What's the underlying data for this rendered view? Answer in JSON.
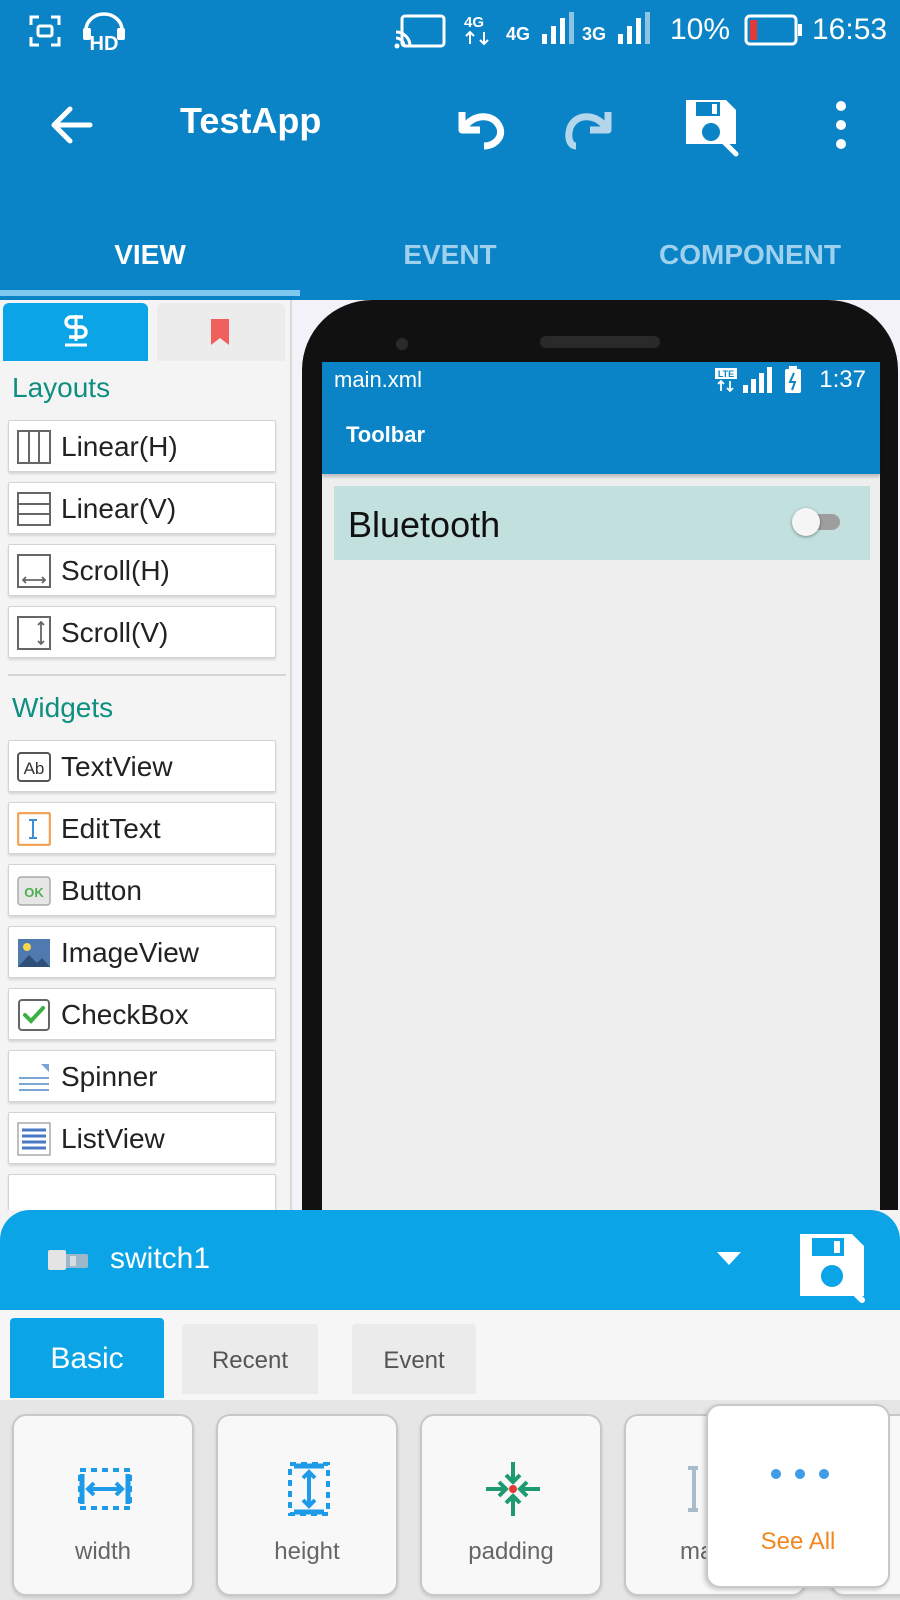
{
  "status_bar": {
    "network_4g_label": "4G",
    "network_3g_label": "3G",
    "battery": "10%",
    "time": "16:53",
    "icons": [
      "screenshot-icon",
      "hd-icon",
      "cast-icon",
      "volte-icon",
      "signal-4g-icon",
      "signal-3g-icon",
      "battery-icon"
    ]
  },
  "app_bar": {
    "title": "TestApp",
    "icons": [
      "back-arrow-icon",
      "undo-icon",
      "redo-icon",
      "save-icon",
      "overflow-menu-icon"
    ]
  },
  "tabs": [
    {
      "label": "VIEW",
      "active": true
    },
    {
      "label": "EVENT",
      "active": false
    },
    {
      "label": "COMPONENT",
      "active": false
    }
  ],
  "palette": {
    "tab_icons": [
      "palette-icon",
      "bookmark-icon"
    ],
    "layouts_title": "Layouts",
    "layouts": [
      {
        "label": "Linear(H)",
        "icon": "linear-horizontal-icon"
      },
      {
        "label": "Linear(V)",
        "icon": "linear-vertical-icon"
      },
      {
        "label": "Scroll(H)",
        "icon": "scroll-horizontal-icon"
      },
      {
        "label": "Scroll(V)",
        "icon": "scroll-vertical-icon"
      }
    ],
    "widgets_title": "Widgets",
    "widgets": [
      {
        "label": "TextView",
        "icon": "textview-icon"
      },
      {
        "label": "EditText",
        "icon": "edittext-icon"
      },
      {
        "label": "Button",
        "icon": "button-icon"
      },
      {
        "label": "ImageView",
        "icon": "imageview-icon"
      },
      {
        "label": "CheckBox",
        "icon": "checkbox-icon"
      },
      {
        "label": "Spinner",
        "icon": "spinner-icon"
      },
      {
        "label": "ListView",
        "icon": "listview-icon"
      }
    ]
  },
  "preview": {
    "file_name": "main.xml",
    "time": "1:37",
    "toolbar_title": "Toolbar",
    "switch_text": "Bluetooth",
    "switch_checked": false
  },
  "bottom_sheet": {
    "selected_widget": "switch1",
    "tabs": [
      {
        "label": "Basic",
        "active": true
      },
      {
        "label": "Recent",
        "active": false
      },
      {
        "label": "Event",
        "active": false
      }
    ],
    "properties": [
      {
        "label": "width",
        "icon": "width-icon"
      },
      {
        "label": "height",
        "icon": "height-icon"
      },
      {
        "label": "padding",
        "icon": "padding-icon"
      },
      {
        "label": "ma",
        "icon": "margin-icon"
      }
    ],
    "see_all": "See All"
  },
  "colors": {
    "primary": "#0a84c6",
    "accent": "#0ba4e6",
    "section_title": "#0e8f80",
    "see_all": "#f2861f",
    "switch_row": "#c2e0de"
  }
}
